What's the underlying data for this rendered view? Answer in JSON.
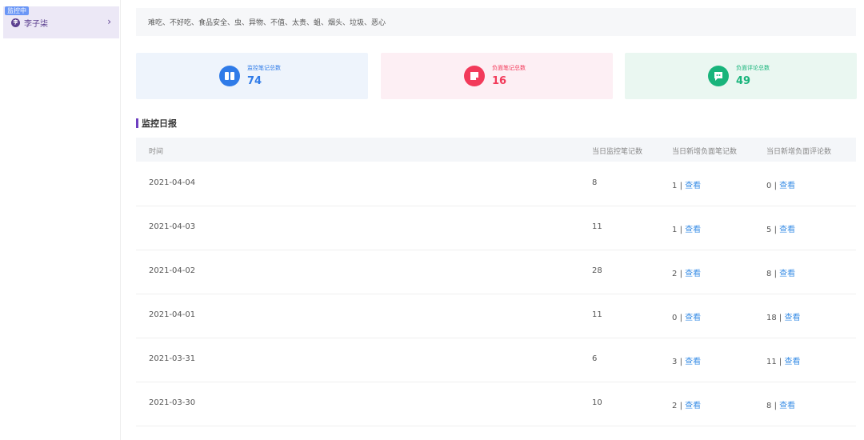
{
  "sidebar": {
    "badge": "监控中",
    "avatar_initial": "李",
    "name": "李子柒",
    "chevron": "›"
  },
  "keywords": "难吃、不好吃、食品安全、虫、异物、不值、太贵、蛆、烟头、垃圾、恶心",
  "stats": {
    "monitor": {
      "label": "监控笔记总数",
      "value": "74",
      "icon": "book-icon",
      "color": "#2f7be8"
    },
    "negative_notes": {
      "label": "负面笔记总数",
      "value": "16",
      "icon": "note-icon",
      "color": "#f23a5a"
    },
    "negative_comments": {
      "label": "负面评论总数",
      "value": "49",
      "icon": "comment-icon",
      "color": "#18b47b"
    }
  },
  "section_title": "监控日报",
  "table": {
    "headers": [
      "时间",
      "当日监控笔记数",
      "当日新增负面笔记数",
      "当日新增负面评论数"
    ],
    "link_label": "查看",
    "separator": "|",
    "rows": [
      {
        "date": "2021-04-04",
        "monitored": "8",
        "neg_notes": "1",
        "neg_comments": "0"
      },
      {
        "date": "2021-04-03",
        "monitored": "11",
        "neg_notes": "1",
        "neg_comments": "5"
      },
      {
        "date": "2021-04-02",
        "monitored": "28",
        "neg_notes": "2",
        "neg_comments": "8"
      },
      {
        "date": "2021-04-01",
        "monitored": "11",
        "neg_notes": "0",
        "neg_comments": "18"
      },
      {
        "date": "2021-03-31",
        "monitored": "6",
        "neg_notes": "3",
        "neg_comments": "11"
      },
      {
        "date": "2021-03-30",
        "monitored": "10",
        "neg_notes": "2",
        "neg_comments": "8"
      }
    ]
  }
}
